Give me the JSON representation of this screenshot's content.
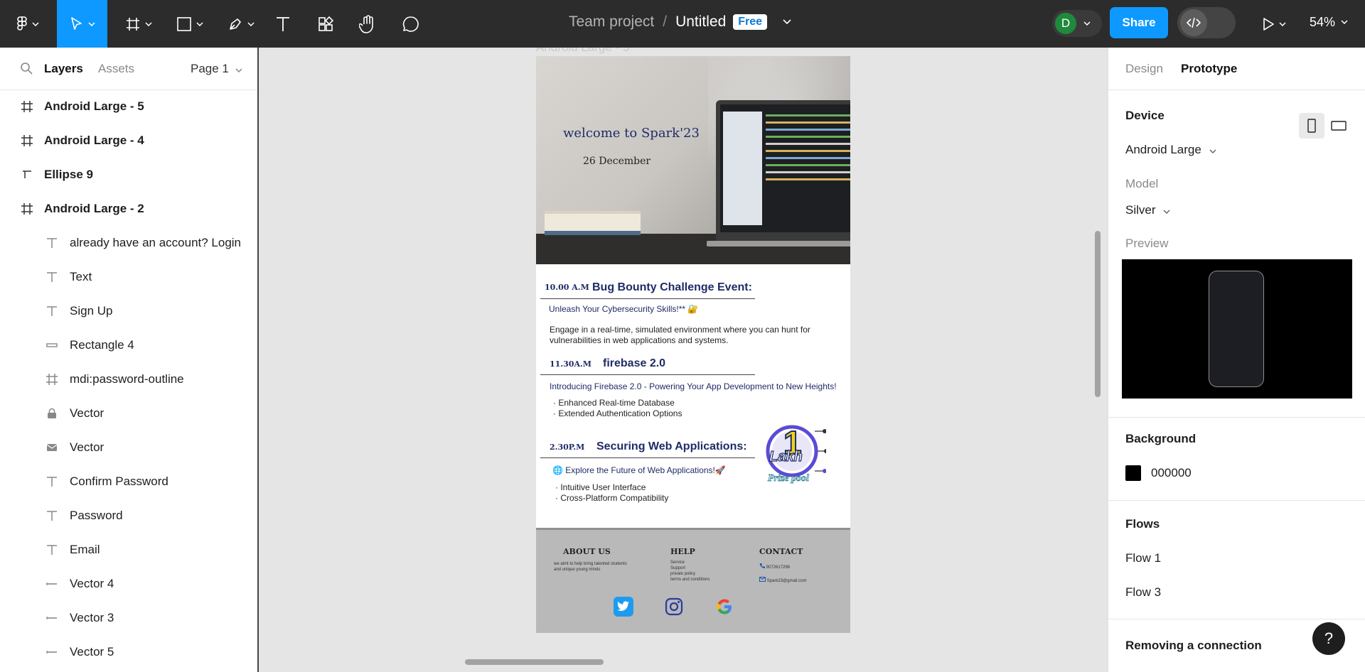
{
  "toolbar": {
    "team": "Team project",
    "separator": "/",
    "file": "Untitled",
    "plan_badge": "Free",
    "avatar_initial": "D",
    "share_label": "Share",
    "zoom": "54%",
    "icons": [
      "figma-menu-icon",
      "move-tool-icon",
      "frame-tool-icon",
      "shape-tool-icon",
      "pen-tool-icon",
      "text-tool-icon",
      "resources-icon",
      "hand-tool-icon",
      "comment-icon",
      "dev-mode-icon",
      "present-icon"
    ]
  },
  "left_panel": {
    "tab_layers": "Layers",
    "tab_assets": "Assets",
    "page": "Page 1",
    "layers": [
      {
        "label": "Android Large - 5",
        "icon": "frame-icon",
        "level": "top"
      },
      {
        "label": "Android Large - 4",
        "icon": "frame-icon",
        "level": "top"
      },
      {
        "label": "Ellipse 9",
        "icon": "vector-icon",
        "level": "top"
      },
      {
        "label": "Android Large - 2",
        "icon": "frame-icon",
        "level": "top"
      },
      {
        "label": "already have an account? Login",
        "icon": "text-icon",
        "level": "child"
      },
      {
        "label": "Text",
        "icon": "text-icon",
        "level": "child"
      },
      {
        "label": "Sign Up",
        "icon": "text-icon",
        "level": "child"
      },
      {
        "label": "Rectangle 4",
        "icon": "rectangle-icon",
        "level": "child"
      },
      {
        "label": "mdi:password-outline",
        "icon": "frame-icon",
        "level": "child"
      },
      {
        "label": "Vector",
        "icon": "lock-icon",
        "level": "child"
      },
      {
        "label": "Vector",
        "icon": "mail-icon",
        "level": "child"
      },
      {
        "label": "Confirm Password",
        "icon": "text-icon",
        "level": "child"
      },
      {
        "label": "Password",
        "icon": "text-icon",
        "level": "child"
      },
      {
        "label": "Email",
        "icon": "text-icon",
        "level": "child"
      },
      {
        "label": "Vector 4",
        "icon": "line-icon",
        "level": "child"
      },
      {
        "label": "Vector 3",
        "icon": "line-icon",
        "level": "child"
      },
      {
        "label": "Vector 5",
        "icon": "line-icon",
        "level": "child"
      }
    ]
  },
  "canvas": {
    "frame_label": "Android Large - 5",
    "hero_title": "welcome to Spark'23",
    "hero_date": "26 December",
    "events": [
      {
        "time": "10.00 A.M",
        "title": "Bug Bounty Challenge Event:",
        "subtitle": "Unleash Your Cybersecurity Skills!** 🔐",
        "body": "Engage in a real-time, simulated environment where you can hunt for vulnerabilities in web applications and systems."
      },
      {
        "time": "11.30A.M",
        "title": "firebase 2.0",
        "subtitle": "Introducing Firebase 2.0 - Powering Your App Development to New Heights!",
        "bullets": [
          "Enhanced Real-time Database",
          "Extended Authentication Options"
        ]
      },
      {
        "time": "2.30P.M",
        "title": "Securing Web Applications:",
        "subtitle": "🌐 Explore the Future of Web Applications!🚀",
        "bullets": [
          "Intuitive User Interface",
          "Cross-Platform Compatibility"
        ]
      }
    ],
    "prize": {
      "number": "1",
      "unit": "Lakh",
      "caption": "Prize pool"
    },
    "footer": {
      "about_heading": "ABOUT US",
      "about_text": "we aimt to help bring talented students and unique young minds",
      "help_heading": "HELP",
      "help_items": [
        "Service",
        "Support",
        "private policy",
        "terms and conditions"
      ],
      "contact_heading": "CONTACT",
      "phone": "9072617296",
      "email": "Spark23@gmail.com",
      "socials": [
        "twitter-icon",
        "instagram-icon",
        "google-icon"
      ]
    }
  },
  "right_panel": {
    "tab_design": "Design",
    "tab_prototype": "Prototype",
    "device_heading": "Device",
    "device_value": "Android Large",
    "model_label": "Model",
    "model_value": "Silver",
    "preview_label": "Preview",
    "background_heading": "Background",
    "background_hex": "000000",
    "background_color": "#000000",
    "flows_heading": "Flows",
    "flows": [
      "Flow 1",
      "Flow 3"
    ],
    "removing_heading": "Removing a connection",
    "help_label": "?"
  },
  "colors": {
    "toolbar": "#2c2c2c",
    "accent": "#0d99ff",
    "event_navy": "#1f2c66"
  }
}
